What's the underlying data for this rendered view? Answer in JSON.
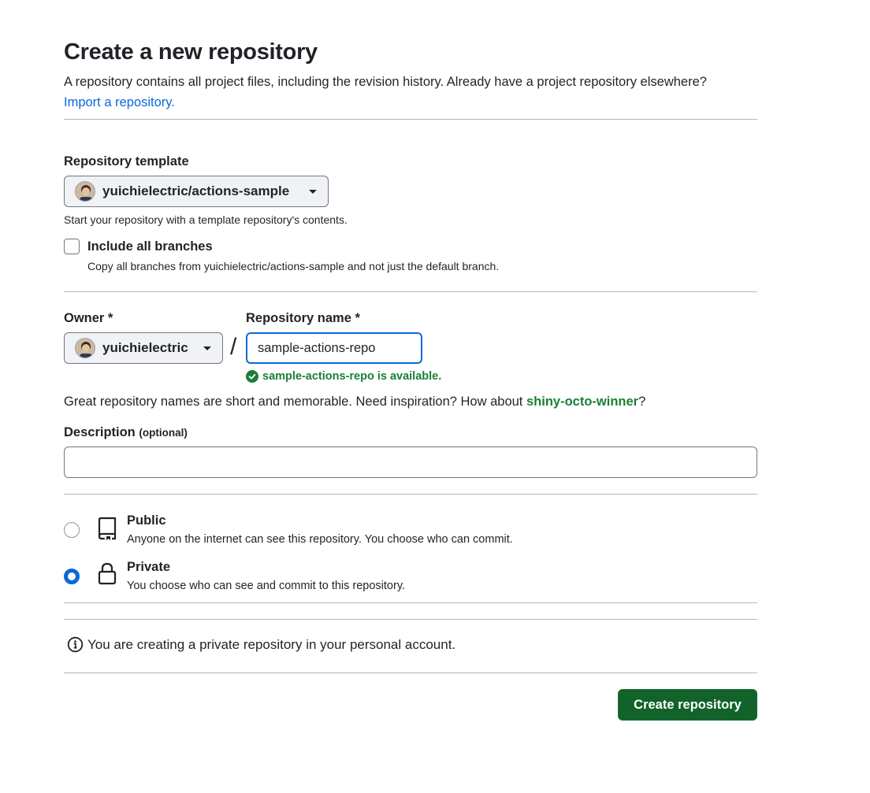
{
  "page": {
    "title": "Create a new repository",
    "intro_text": "A repository contains all project files, including the revision history. Already have a project repository elsewhere?",
    "import_link": "Import a repository."
  },
  "template": {
    "label": "Repository template",
    "selected": "yuichielectric/actions-sample",
    "help": "Start your repository with a template repository's contents.",
    "include_branches_label": "Include all branches",
    "include_branches_checked": false,
    "include_branches_help": "Copy all branches from yuichielectric/actions-sample and not just the default branch."
  },
  "owner": {
    "label": "Owner *",
    "selected": "yuichielectric"
  },
  "separator": "/",
  "repo_name": {
    "label": "Repository name *",
    "value": "sample-actions-repo",
    "availability": "sample-actions-repo is available."
  },
  "suggestion": {
    "text": "Great repository names are short and memorable. Need inspiration? How about",
    "name": "shiny-octo-winner",
    "suffix": "?"
  },
  "description": {
    "label": "Description",
    "optional": "(optional)",
    "value": ""
  },
  "visibility": {
    "options": [
      {
        "title": "Public",
        "description": "Anyone on the internet can see this repository. You choose who can commit.",
        "icon": "repo-icon",
        "checked": false
      },
      {
        "title": "Private",
        "description": "You choose who can see and commit to this repository.",
        "icon": "lock-icon",
        "checked": true
      }
    ]
  },
  "info_message": "You are creating a private repository in your personal account.",
  "submit_label": "Create repository",
  "colors": {
    "primary_button": "#116329",
    "link": "#0969da",
    "success": "#1a7f37"
  }
}
